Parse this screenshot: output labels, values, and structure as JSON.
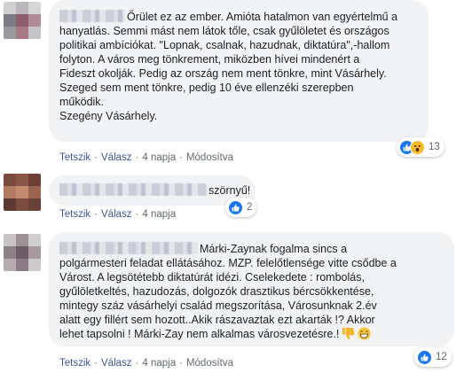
{
  "colors": {
    "bubble_bg": "#f2f3f5",
    "link": "#385898",
    "like_blue": "#1877f2",
    "wow_yellow": "#f7b928"
  },
  "comments": [
    {
      "author": "",
      "lines": [
        "Őrület ez az ember. Amióta hatalmon van egyértelmű a",
        "hanyatlás. Semmi mást nem látok tőle, csak gyűlöletet és országos",
        "politikai ambíciókat. \"Lopnak, csalnak, hazudnak, diktatúra\",-hallom",
        "folyton. A város meg tönkrement, miközben hívei mindenért a",
        "Fideszt okolják. Pedig az ország nem ment tönkre, mint Vásárhely.",
        "Szeged sem ment tönkre, pedig 10 éve ellenzéki szerepben",
        "működik.",
        "Szegény Vásárhely."
      ],
      "actions": {
        "like": "Tetszik",
        "reply": "Válasz",
        "time": "4 napja",
        "edited": "Módosítva"
      },
      "reaction_icons": [
        "like-icon",
        "wow-icon"
      ],
      "reaction_count": "13"
    },
    {
      "author": "",
      "lines": [
        "szörnyű!"
      ],
      "actions": {
        "like": "Tetszik",
        "reply": "Válasz",
        "time": "4 napja"
      },
      "reaction_icons": [
        "like-icon"
      ],
      "reaction_count": "2"
    },
    {
      "author": "",
      "lines": [
        "Márki-Zaynak fogalma sincs a",
        "polgármesteri feladat ellátásához. MZP. felelőtlensége vitte csődbe a",
        "Várost. A legsötétebb diktatúrát idézi. Cselekedete : rombolás,",
        "gyűlöletkeltés, hazudozás, dolgozók drasztikus bércsökkentése,",
        "mintegy száz vásárhelyi család megszorítása, Városunknak 2.év",
        "alatt egy fillért sem hozott..Akik rászavaztak ezt akarták !? Akkor",
        "lehet tapsolni ! Márki-Zay nem alkalmas városvezetésre.!"
      ],
      "inline_emojis": [
        "thumbs-down-icon",
        "grin-icon"
      ],
      "actions": {
        "like": "Tetszik",
        "reply": "Válasz",
        "time": "4 napja",
        "edited": "Módosítva"
      },
      "reaction_icons": [
        "like-icon"
      ],
      "reaction_count": "12"
    }
  ]
}
